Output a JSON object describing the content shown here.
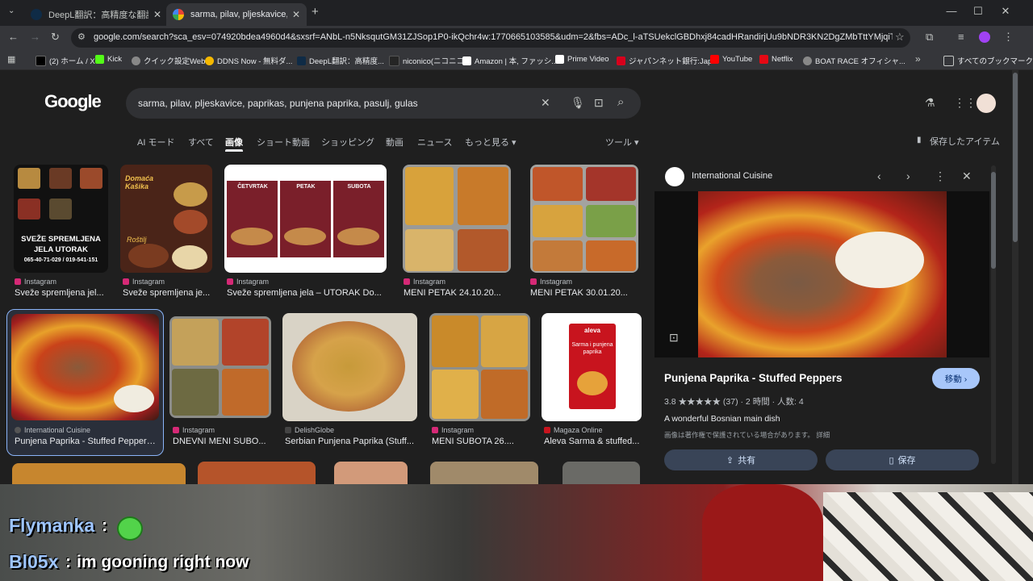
{
  "browser": {
    "tabs": [
      {
        "label": "DeepL翻訳：高精度な翻訳ツール",
        "active": false
      },
      {
        "label": "sarma, pilav, pljeskavice, paprik",
        "active": true
      }
    ],
    "new_tab": "+",
    "url": "google.com/search?sca_esv=074920bdea4960d4&sxsrf=ANbL-n5NksqutGM31ZJSop1P0-ikQchr4w:1770665103585&udm=2&fbs=ADc_l-aTSUekclGBDhxj84cadHRandirjUu9bNDR3KN2DgZMbTttYMjqiTkPpcw4eBa...",
    "bookmarks": [
      {
        "label": "(2) ホーム / X",
        "color": "#000000"
      },
      {
        "label": "Kick",
        "color": "#53fc18"
      },
      {
        "label": "クイック設定Web",
        "color": "#888888"
      },
      {
        "label": "DDNS Now - 無料ダ...",
        "color": "#f5b800"
      },
      {
        "label": "DeepL翻訳：高精度...",
        "color": "#0f2b46"
      },
      {
        "label": "niconico(ニコニコ)",
        "color": "#252525"
      },
      {
        "label": "Amazon | 本, ファッシ...",
        "color": "#ffffff"
      },
      {
        "label": "Prime Video",
        "color": "#ffffff"
      },
      {
        "label": "ジャパンネット銀行:Jap...",
        "color": "#d7001c"
      },
      {
        "label": "YouTube",
        "color": "#ff0000"
      },
      {
        "label": "Netflix",
        "color": "#e50914"
      },
      {
        "label": "BOAT RACE オフィシャ...",
        "color": "#888888"
      }
    ],
    "bookmarks_more": "»",
    "all_bookmarks": "すべてのブックマーク"
  },
  "google": {
    "logo": "Google",
    "query": "sarma, pilav, pljeskavice, paprikas, punjena paprika, pasulj, gulas",
    "nav": [
      "AI モード",
      "すべて",
      "画像",
      "ショート動画",
      "ショッピング",
      "動画",
      "ニュース",
      "もっと見る ▾"
    ],
    "tools": "ツール ▾",
    "saved": "保存したアイテム",
    "results_row1": [
      {
        "source": "Instagram",
        "caption": "Sveže spremljena jel..."
      },
      {
        "source": "Instagram",
        "caption": "Sveže spremljena je..."
      },
      {
        "source": "Instagram",
        "caption": "Sveže spremljena jela – UTORAK Do..."
      },
      {
        "source": "Instagram",
        "caption": "MENI PETAK 24.10.20..."
      },
      {
        "source": "Instagram",
        "caption": "MENI PETAK 30.01.20..."
      }
    ],
    "results_row2": [
      {
        "source": "International Cuisine",
        "caption": "Punjena Paprika - Stuffed Peppers..."
      },
      {
        "source": "Instagram",
        "caption": "DNEVNI MENI SUBO..."
      },
      {
        "source": "DelishGlobe",
        "caption": "Serbian Punjena Paprika (Stuff..."
      },
      {
        "source": "Instagram",
        "caption": "MENI SUBOTA 26...."
      },
      {
        "source": "Magaza Online",
        "caption": "Aleva Sarma & stuffed..."
      }
    ],
    "thumb_texts": {
      "t1": "SVEŽE SPREMLJENA JELA UTORAK",
      "t1_phone": "065-40-71-029 / 019-541-151",
      "t2": "Domaća Kašika",
      "t2_sub": "Roštilj",
      "t3": [
        "ČETVRTAK",
        "PETAK",
        "SUBOTA"
      ],
      "t5": "aleva",
      "t5_sub": "Sarma i punjena paprika"
    }
  },
  "panel": {
    "site": "International Cuisine",
    "title": "Punjena Paprika - Stuffed Peppers",
    "move_button": "移動 ›",
    "rating": "3.8 ★★★★★ (37) · 2 時間 · 人数: 4",
    "description": "A wonderful Bosnian main dish",
    "copyright": "画像は著作権で保護されている場合があります。 詳細",
    "share": "共有",
    "save": "保存"
  },
  "stream": {
    "chat": [
      {
        "user": "Flymanka",
        "sep": ":",
        "message": ""
      },
      {
        "user": "Bl05x",
        "sep": ":",
        "message": "im gooning right now"
      }
    ]
  }
}
